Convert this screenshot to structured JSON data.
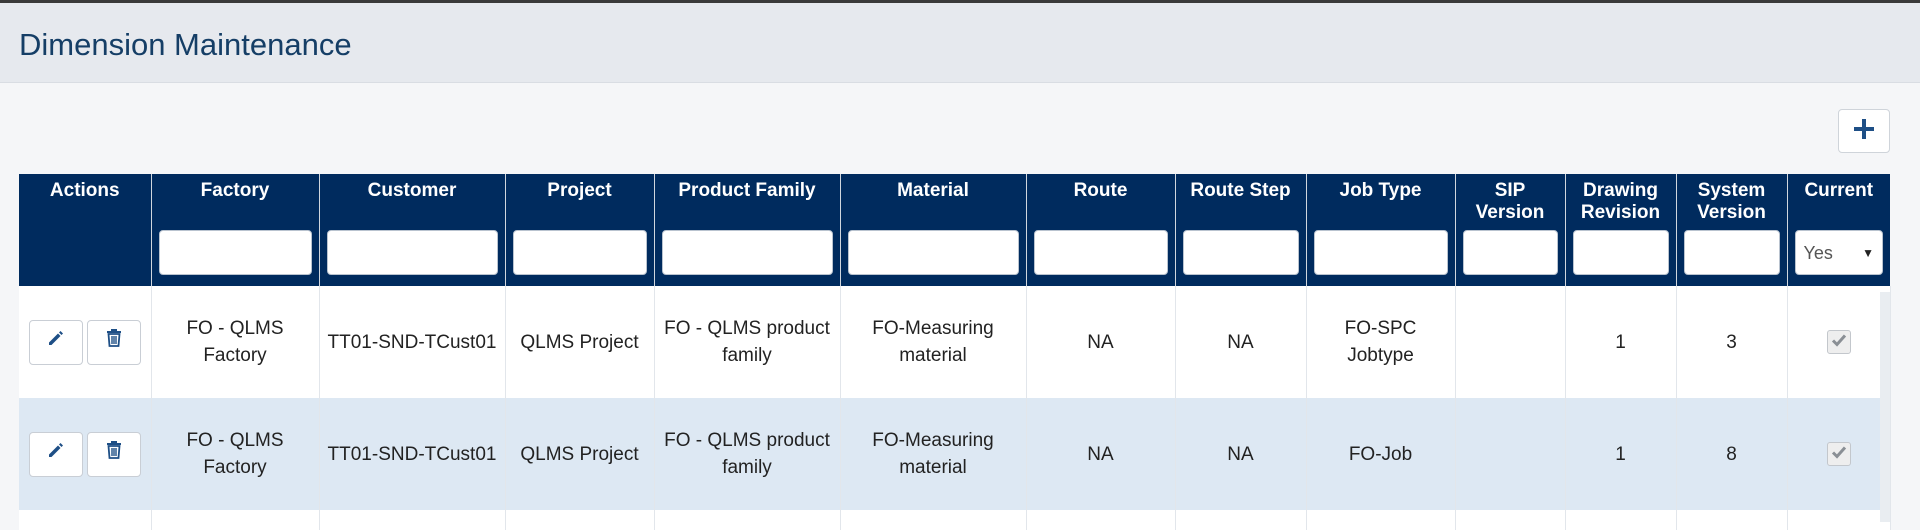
{
  "page": {
    "title": "Dimension Maintenance"
  },
  "toolbar": {
    "add_icon": "plus-icon"
  },
  "table": {
    "columns": [
      {
        "key": "actions",
        "label": "Actions",
        "filter": "none"
      },
      {
        "key": "factory",
        "label": "Factory",
        "filter": "text",
        "value": ""
      },
      {
        "key": "customer",
        "label": "Customer",
        "filter": "text",
        "value": ""
      },
      {
        "key": "project",
        "label": "Project",
        "filter": "text",
        "value": ""
      },
      {
        "key": "product_family",
        "label": "Product Family",
        "filter": "text",
        "value": ""
      },
      {
        "key": "material",
        "label": "Material",
        "filter": "text",
        "value": ""
      },
      {
        "key": "route",
        "label": "Route",
        "filter": "text",
        "value": ""
      },
      {
        "key": "route_step",
        "label": "Route Step",
        "filter": "text",
        "value": ""
      },
      {
        "key": "job_type",
        "label": "Job Type",
        "filter": "text",
        "value": ""
      },
      {
        "key": "sip_version",
        "label": "SIP Version",
        "filter": "text",
        "value": ""
      },
      {
        "key": "drawing_revision",
        "label": "Drawing Revision",
        "filter": "text",
        "value": ""
      },
      {
        "key": "system_version",
        "label": "System Version",
        "filter": "text",
        "value": ""
      },
      {
        "key": "current",
        "label": "Current",
        "filter": "select",
        "value": "Yes"
      }
    ],
    "rows": [
      {
        "factory": "FO - QLMS Factory",
        "customer": "TT01-SND-TCust01",
        "project": "QLMS Project",
        "product_family": "FO - QLMS product family",
        "material": "FO-Measuring material",
        "route": "NA",
        "route_step": "NA",
        "job_type": "FO-SPC Jobtype",
        "sip_version": "",
        "drawing_revision": "1",
        "system_version": "3",
        "current": true
      },
      {
        "factory": "FO - QLMS Factory",
        "customer": "TT01-SND-TCust01",
        "project": "QLMS Project",
        "product_family": "FO - QLMS product family",
        "material": "FO-Measuring material",
        "route": "NA",
        "route_step": "NA",
        "job_type": "FO-Job",
        "sip_version": "",
        "drawing_revision": "1",
        "system_version": "8",
        "current": true
      }
    ]
  },
  "colors": {
    "header_bg": "#002b5e",
    "title": "#153e66",
    "row_alt": "#dde8f3",
    "icon": "#1e4f86"
  },
  "icons": {
    "edit": "pencil-icon",
    "delete": "trash-icon",
    "check": "check-icon",
    "dropdown": "caret-down-icon"
  }
}
